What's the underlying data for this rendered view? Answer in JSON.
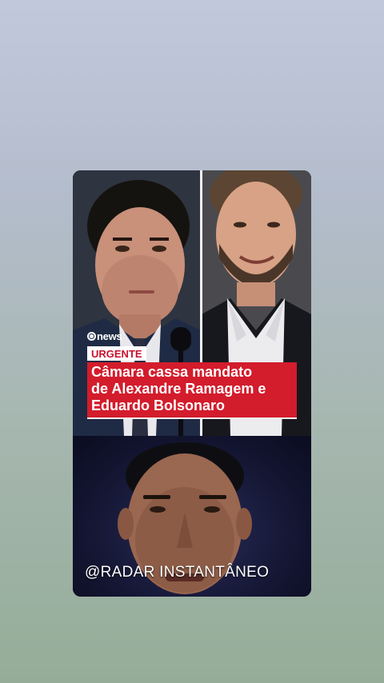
{
  "brand": {
    "logo_icon": "globo-circle-icon",
    "name": "news"
  },
  "badge": {
    "label": "URGENTE"
  },
  "headline": {
    "lines": [
      "Câmara cassa mandato",
      "de Alexandre Ramagem e",
      "Eduardo Bolsonaro"
    ]
  },
  "watermark": {
    "text": "@RADAR INSTANTÂNEO"
  },
  "colors": {
    "headline_bg": "#d31c2c",
    "badge_text": "#c8102e",
    "background_top": "#c2c8dc",
    "background_bottom": "#95ad98"
  }
}
